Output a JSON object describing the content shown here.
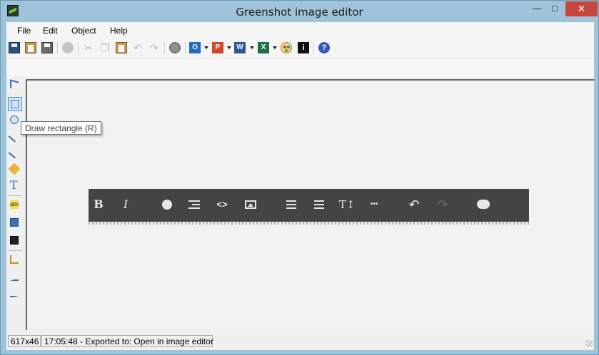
{
  "window": {
    "title": "Greenshot image editor",
    "controls": {
      "minimize": "—",
      "maximize": "□",
      "close": "✕"
    },
    "accent_color": "#9fc3d9",
    "close_color": "#c9463d"
  },
  "menu": {
    "items": [
      {
        "label": "File"
      },
      {
        "label": "Edit"
      },
      {
        "label": "Object"
      },
      {
        "label": "Help"
      }
    ]
  },
  "toolbar": {
    "icons": [
      "save-icon",
      "clipboard-icon",
      "print-icon",
      "delete-icon",
      "cut-icon",
      "copy-icon",
      "paste-icon",
      "undo-icon",
      "redo-icon",
      "settings-icon",
      "outlook-icon",
      "powerpoint-icon",
      "word-icon",
      "excel-icon",
      "paint-icon",
      "imgur-icon",
      "help-icon"
    ],
    "outlook_glyph": "O",
    "powerpoint_glyph": "P",
    "word_glyph": "W",
    "excel_glyph": "X",
    "imgur_glyph": "i",
    "help_glyph": "?"
  },
  "tools": {
    "icons": [
      "select-icon",
      "rectangle-icon",
      "ellipse-icon",
      "line-icon",
      "arrow-icon",
      "freehand-icon",
      "text-icon",
      "highlight-icon",
      "obfuscate-icon",
      "step-label-icon",
      "crop-icon",
      "rotate-left-icon",
      "rotate-right-icon"
    ],
    "text_glyph": "T",
    "highlight_glyph": "abc",
    "selected": "rectangle-icon"
  },
  "tooltip": {
    "text": "Draw rectangle (R)"
  },
  "image": {
    "editor_toolbar_icons": [
      "bold-icon",
      "italic-icon",
      "globe-icon",
      "indent-icon",
      "code-icon",
      "image-icon",
      "ordered-list-icon",
      "unordered-list-icon",
      "text-size-icon",
      "more-icon",
      "undo-icon",
      "redo-icon",
      "comment-icon"
    ],
    "bold_glyph": "B",
    "italic_glyph": "I",
    "code_glyph": "<>",
    "text_size_glyph": "T↕",
    "more_glyph": "•••",
    "undo_glyph": "↶",
    "redo_glyph": "↷"
  },
  "status": {
    "dimensions": "617x46",
    "message": "17:05:48 - Exported to: Open in image editor"
  }
}
